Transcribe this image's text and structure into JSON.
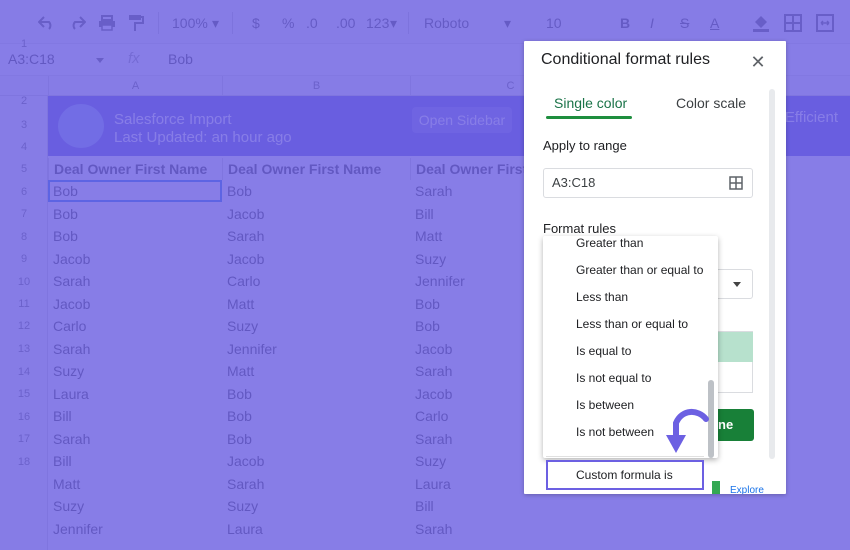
{
  "toolbar": {
    "zoom": "100%",
    "currency": "$",
    "percent": "%",
    "dec_decrease": ".0",
    "dec_increase": ".00",
    "number_format": "123",
    "font": "Roboto",
    "font_size": "10",
    "bold": "B",
    "italic": "I",
    "strike": "S",
    "text_color": "A"
  },
  "formula_bar": {
    "name_box": "A3:C18",
    "fx": "fx",
    "value": "Bob"
  },
  "grid": {
    "col_headers": [
      "A",
      "B",
      "C"
    ],
    "row_numbers": [
      "1",
      "2",
      "3",
      "4",
      "5",
      "6",
      "7",
      "8",
      "9",
      "10",
      "11",
      "12",
      "13",
      "14",
      "15",
      "16",
      "17",
      "18"
    ],
    "banner": {
      "title": "Salesforce Import",
      "subtitle": "Last Updated: an hour ago",
      "button": "Open Sidebar",
      "right_text": "Efficient"
    },
    "headers": [
      "Deal Owner First Name",
      "Deal Owner First Name",
      "Deal Owner First N"
    ],
    "rows": [
      [
        "Bob",
        "Bob",
        "Sarah"
      ],
      [
        "Bob",
        "Jacob",
        "Bill"
      ],
      [
        "Bob",
        "Sarah",
        "Matt"
      ],
      [
        "Jacob",
        "Jacob",
        "Suzy"
      ],
      [
        "Sarah",
        "Carlo",
        "Jennifer"
      ],
      [
        "Jacob",
        "Matt",
        "Bob"
      ],
      [
        "Carlo",
        "Suzy",
        "Bob"
      ],
      [
        "Sarah",
        "Jennifer",
        "Jacob"
      ],
      [
        "Suzy",
        "Matt",
        "Sarah"
      ],
      [
        "Laura",
        "Bob",
        "Jacob"
      ],
      [
        "Bill",
        "Bob",
        "Carlo"
      ],
      [
        "Sarah",
        "Bob",
        "Sarah"
      ],
      [
        "Bill",
        "Jacob",
        "Suzy"
      ],
      [
        "Matt",
        "Sarah",
        "Laura"
      ],
      [
        "Suzy",
        "Suzy",
        "Bill"
      ],
      [
        "Jennifer",
        "Laura",
        "Sarah"
      ]
    ]
  },
  "panel": {
    "title": "Conditional format rules",
    "tabs": [
      "Single color",
      "Color scale"
    ],
    "apply_to_range_label": "Apply to range",
    "range_value": "A3:C18",
    "format_rules_label": "Format rules",
    "done_label": "ne",
    "explore_label": "Explore"
  },
  "menu": {
    "items": [
      "Greater than",
      "Greater than or equal to",
      "Less than",
      "Less than or equal to",
      "Is equal to",
      "Is not equal to",
      "Is between",
      "Is not between"
    ],
    "highlighted": "Custom formula is"
  },
  "colors": {
    "overlay": "#6c60e2",
    "accent_green": "#188038",
    "selection_border": "#6c60e2"
  }
}
